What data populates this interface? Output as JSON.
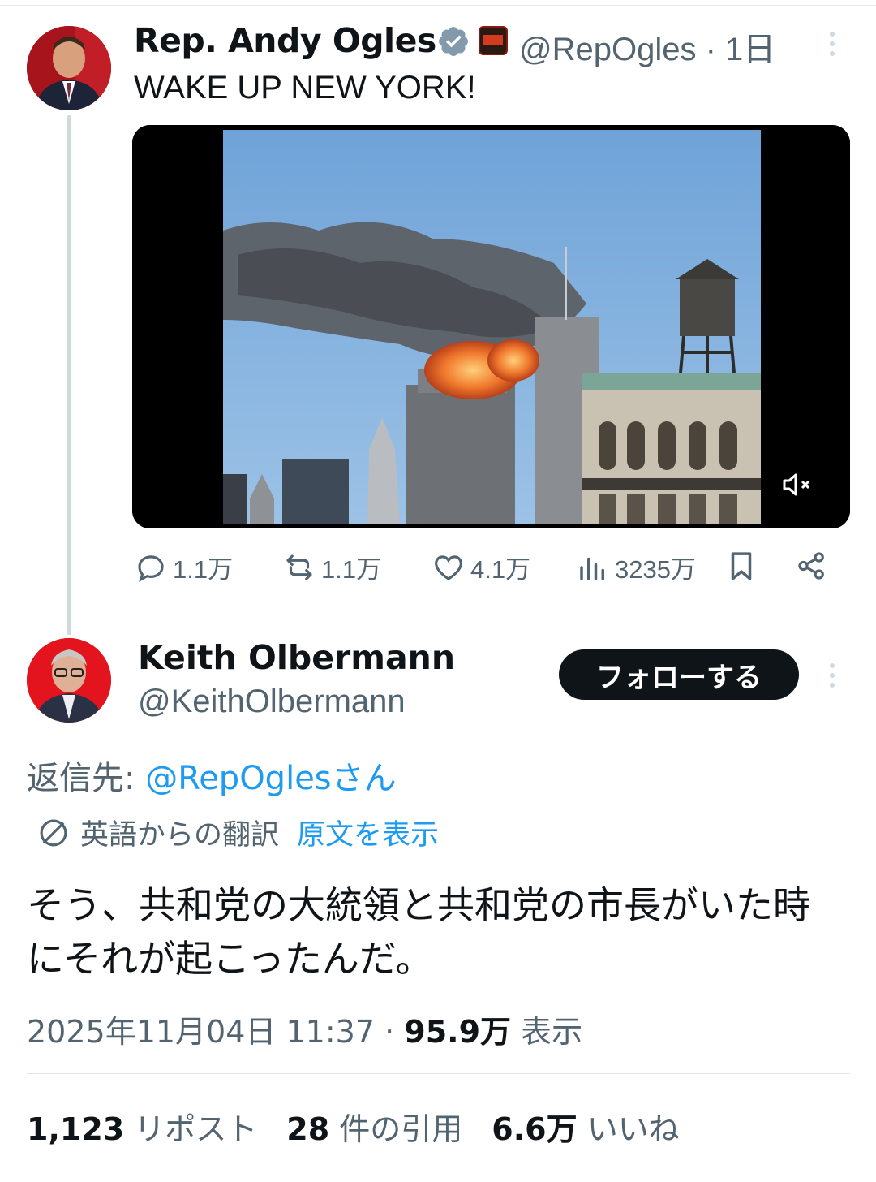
{
  "tweet1": {
    "display_name": "Rep. Andy Ogles",
    "handle": "@RepOgles",
    "time": "· 1日",
    "text": "WAKE UP NEW YORK!",
    "stats": {
      "replies": "1.1万",
      "retweets": "1.1万",
      "likes": "4.1万",
      "views": "3235万"
    }
  },
  "tweet2": {
    "display_name": "Keith Olbermann",
    "handle": "@KeithOlbermann",
    "follow_label": "フォローする",
    "reply_to_prefix": "返信先: ",
    "reply_to_mention": "@RepOglesさん",
    "translated_from": "英語からの翻訳",
    "show_original": "原文を表示",
    "text": "そう、共和党の大統領と共和党の市長がいた時にそれが起こったんだ。",
    "timestamp": "2025年11月04日 11:37 · ",
    "view_count": "95.9万",
    "view_label": " 表示",
    "reposts_count": "1,123",
    "reposts_label": " リポスト",
    "quotes_count": "28",
    "quotes_label": " 件の引用",
    "likes_count": "6.6万",
    "likes_label": " いいね"
  },
  "colors": {
    "accent": "#1d9bf0",
    "secondary_text": "#536471",
    "primary_text": "#0f1419"
  }
}
